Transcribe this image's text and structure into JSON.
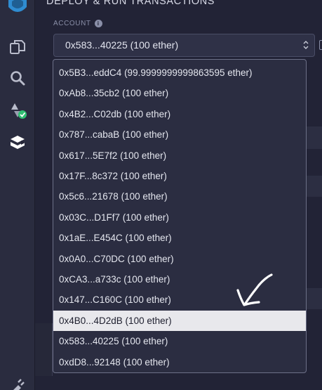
{
  "panel": {
    "title": "DEPLOY & RUN TRANSACTIONS",
    "account_label": "ACCOUNT",
    "info_icon_glyph": "i",
    "selected_account": "0x583...40225 (100 ether)"
  },
  "rail": {
    "icons": [
      "remix-logo-icon",
      "file-explorer-icon",
      "search-icon",
      "solidity-compiler-icon",
      "deploy-run-icon",
      "plugin-icon"
    ]
  },
  "accounts": [
    "0x5B3...eddC4 (99.9999999999863595 ether)",
    "0xAb8...35cb2 (100 ether)",
    "0x4B2...C02db (100 ether)",
    "0x787...cabaB (100 ether)",
    "0x617...5E7f2 (100 ether)",
    "0x17F...8c372 (100 ether)",
    "0x5c6...21678 (100 ether)",
    "0x03C...D1Ff7 (100 ether)",
    "0x1aE...E454C (100 ether)",
    "0x0A0...C70DC (100 ether)",
    "0xCA3...a733c (100 ether)",
    "0x147...C160C (100 ether)",
    "0x4B0...4D2dB (100 ether)",
    "0x583...40225 (100 ether)",
    "0xdD8...92148 (100 ether)"
  ],
  "highlighted_index": 12,
  "colors": {
    "background": "#222336",
    "rail": "#2a2c3f",
    "dropdown_bg": "#2b2d41",
    "highlight": "#e8e8ec",
    "accent_blue": "#2f8cd1",
    "check_green": "#2fbf71"
  }
}
